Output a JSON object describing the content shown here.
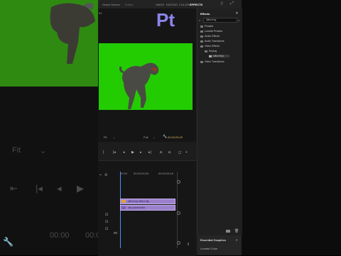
{
  "app": {
    "sequence_name": "Green Screen",
    "sequence_state": "Edited",
    "workspace_tabs": [
      {
        "label": "SMOO",
        "active": false
      },
      {
        "label": "EDITING",
        "active": false
      },
      {
        "label": "COLOR",
        "active": false
      },
      {
        "label": "EFFECTS",
        "active": true
      }
    ],
    "logo_text": "Pt",
    "accent_color": "#8c84ef",
    "top_left_label": "01"
  },
  "monitor": {
    "fit_label": "Fit",
    "full_label": "Full",
    "timecode": "00;00;05;29"
  },
  "timeline": {
    "ruler_ticks": [
      "00;00",
      "00;00;00;00",
      "00;00;05;15"
    ],
    "clip_v2_label": "Ultra Key effect clip",
    "clip_v1_label": "clip placeholder"
  },
  "effects_panel": {
    "title": "Effects",
    "search_value": "Ultra Key",
    "tree": [
      {
        "label": "Presets",
        "depth": 0
      },
      {
        "label": "Lumetri Presets",
        "depth": 0
      },
      {
        "label": "Audio Effects",
        "depth": 0
      },
      {
        "label": "Audio Transitions",
        "depth": 0
      },
      {
        "label": "Video Effects",
        "depth": 0
      },
      {
        "label": "Keying",
        "depth": 1
      },
      {
        "label": "Ultra Key",
        "depth": 2,
        "selected": true
      },
      {
        "label": "Video Transitions",
        "depth": 0
      }
    ],
    "bottom_tab": "Essential Graphics",
    "bottom_item": "Lumetri Color"
  },
  "background": {
    "left_fit_label": "Fit",
    "left_timecode": "00:00",
    "left_timecode_2": "00:0"
  }
}
